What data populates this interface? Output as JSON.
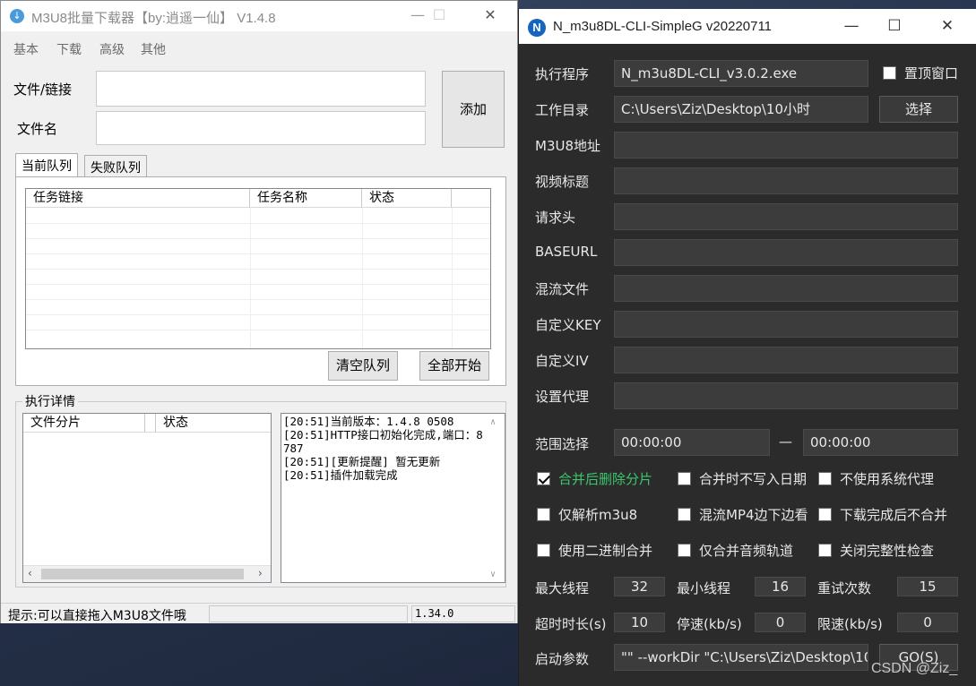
{
  "left_window": {
    "title": "M3U8批量下载器【by:逍遥一仙】 V1.4.8",
    "controls": {
      "minimize": "—",
      "maximize": "☐",
      "close": "✕"
    },
    "menu": [
      "基本",
      "下载",
      "高级",
      "其他"
    ],
    "file_link_label": "文件/链接",
    "file_link_value": "",
    "file_name_label": "文件名",
    "file_name_value": "",
    "add_button": "添加",
    "tabs": [
      "当前队列",
      "失败队列"
    ],
    "queue_columns": [
      "任务链接",
      "任务名称",
      "状态"
    ],
    "clear_queue_button": "清空队列",
    "start_all_button": "全部开始",
    "details_group": "执行详情",
    "detail_columns": [
      "文件分片",
      "状态"
    ],
    "log_lines": [
      "[20:51]当前版本：1.4.8 0508",
      "[20:51]HTTP接口初始化完成,端口：8787",
      "[20:51][更新提醒] 暂无更新",
      "[20:51]插件加载完成"
    ],
    "status_hint": "提示:可以直接拖入M3U8文件哦",
    "status_middle": "",
    "status_version": "1.34.0"
  },
  "right_window": {
    "title": "N_m3u8DL-CLI-SimpleG v20220711",
    "controls": {
      "minimize": "—",
      "maximize": "☐",
      "close": "✕"
    },
    "exe_label": "执行程序",
    "exe_value": "N_m3u8DL-CLI_v3.0.2.exe",
    "topmost_label": "置顶窗口",
    "topmost_checked": false,
    "workdir_label": "工作目录",
    "workdir_value": "C:\\Users\\Ziz\\Desktop\\10小时",
    "select_button": "选择",
    "m3u8_label": "M3U8地址",
    "m3u8_value": "",
    "title_label": "视频标题",
    "title_value": "",
    "headers_label": "请求头",
    "headers_value": "",
    "baseurl_label": "BASEURL",
    "baseurl_value": "",
    "mux_label": "混流文件",
    "mux_value": "",
    "key_label": "自定义KEY",
    "key_value": "",
    "iv_label": "自定义IV",
    "iv_value": "",
    "proxy_label": "设置代理",
    "proxy_value": "",
    "range_label": "范围选择",
    "range_start": "00:00:00",
    "range_dash": "—",
    "range_end": "00:00:00",
    "options": [
      {
        "label": "合并后删除分片",
        "checked": true
      },
      {
        "label": "合并时不写入日期",
        "checked": false
      },
      {
        "label": "不使用系统代理",
        "checked": false
      },
      {
        "label": "仅解析m3u8",
        "checked": false
      },
      {
        "label": "混流MP4边下边看",
        "checked": false
      },
      {
        "label": "下载完成后不合并",
        "checked": false
      },
      {
        "label": "使用二进制合并",
        "checked": false
      },
      {
        "label": "仅合并音频轨道",
        "checked": false
      },
      {
        "label": "关闭完整性检查",
        "checked": false
      }
    ],
    "max_threads_label": "最大线程",
    "max_threads": "32",
    "min_threads_label": "最小线程",
    "min_threads": "16",
    "retry_label": "重试次数",
    "retry": "15",
    "timeout_label": "超时时长(s)",
    "timeout": "10",
    "stop_speed_label": "停速(kb/s)",
    "stop_speed": "0",
    "limit_speed_label": "限速(kb/s)",
    "limit_speed": "0",
    "args_label": "启动参数",
    "args_value": "\"\" --workDir \"C:\\Users\\Ziz\\Desktop\\10",
    "go_button": "GO(S)"
  },
  "watermark": "CSDN @Ziz_"
}
